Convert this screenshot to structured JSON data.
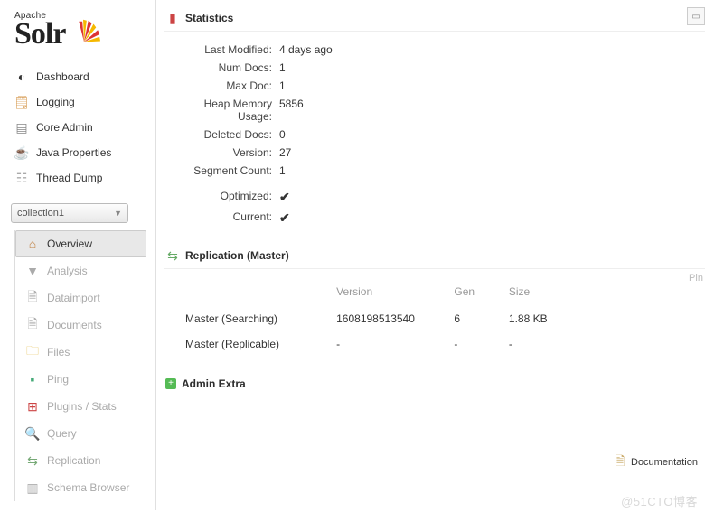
{
  "logo": {
    "prefix": "Apache",
    "name": "Solr"
  },
  "nav": {
    "dashboard": "Dashboard",
    "logging": "Logging",
    "core_admin": "Core Admin",
    "java_properties": "Java Properties",
    "thread_dump": "Thread Dump"
  },
  "core_selector": {
    "value": "collection1"
  },
  "submenu": {
    "overview": "Overview",
    "analysis": "Analysis",
    "dataimport": "Dataimport",
    "documents": "Documents",
    "files": "Files",
    "ping": "Ping",
    "plugins": "Plugins / Stats",
    "query": "Query",
    "replication": "Replication",
    "schema": "Schema Browser"
  },
  "statistics": {
    "title": "Statistics",
    "labels": {
      "last_modified": "Last Modified:",
      "num_docs": "Num Docs:",
      "max_doc": "Max Doc:",
      "heap": "Heap Memory Usage:",
      "deleted": "Deleted Docs:",
      "version": "Version:",
      "segment": "Segment Count:",
      "optimized": "Optimized:",
      "current": "Current:"
    },
    "values": {
      "last_modified": "4 days ago",
      "num_docs": "1",
      "max_doc": "1",
      "heap": "5856",
      "deleted": "0",
      "version": "27",
      "segment": "1"
    }
  },
  "replication": {
    "title": "Replication (Master)",
    "headers": {
      "version": "Version",
      "gen": "Gen",
      "size": "Size"
    },
    "rows": [
      {
        "name": "Master (Searching)",
        "version": "1608198513540",
        "gen": "6",
        "size": "1.88 KB"
      },
      {
        "name": "Master (Replicable)",
        "version": "-",
        "gen": "-",
        "size": "-"
      }
    ]
  },
  "admin_extra": {
    "title": "Admin Extra"
  },
  "footer": {
    "documentation": "Documentation"
  },
  "right": {
    "pin": "Pin"
  },
  "watermark": "@51CTO博客"
}
